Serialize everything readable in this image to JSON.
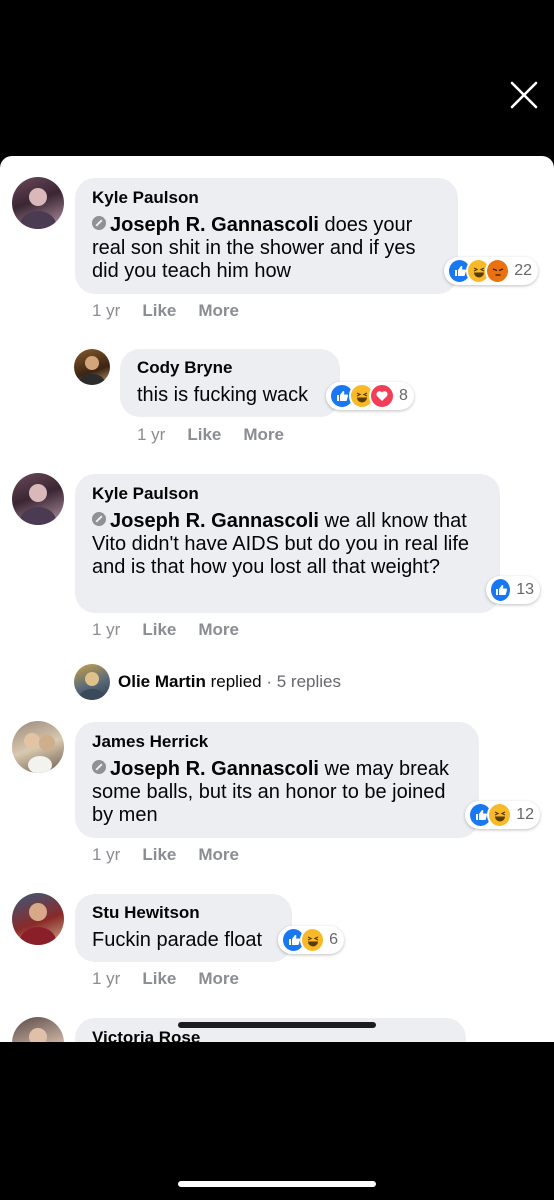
{
  "colors": {
    "like_blue": "#1877f2",
    "haha_yellow": "#f7b928",
    "angry_orange": "#e9710f",
    "love_red": "#f33e58",
    "bubble_gray": "#eceef2",
    "meta_gray": "#8a8d91"
  },
  "actions": {
    "like": "Like",
    "more": "More"
  },
  "comments": [
    {
      "author": "Kyle Paulson",
      "tag": "Joseph R. Gannascoli",
      "text": " does your real son shit in the shower and if yes did you teach him how",
      "reactions": [
        "like",
        "haha",
        "angry"
      ],
      "reaction_count": "22",
      "time": "1 yr"
    },
    {
      "author": "Cody Bryne",
      "text": "this is fucking wack",
      "reactions": [
        "like",
        "haha",
        "love"
      ],
      "reaction_count": "8",
      "time": "1 yr"
    },
    {
      "author": "Kyle Paulson",
      "tag": "Joseph R. Gannascoli",
      "text": " we all know that Vito didn't have AIDS but do you in real life and is that how you lost all that weight?",
      "reactions": [
        "like"
      ],
      "reaction_count": "13",
      "time": "1 yr"
    },
    {
      "author": "James Herrick",
      "tag": "Joseph R. Gannascoli",
      "text": " we may break some balls, but its an honor to be joined by men",
      "reactions": [
        "like",
        "haha"
      ],
      "reaction_count": "12",
      "time": "1 yr"
    },
    {
      "author": "Stu Hewitson",
      "text": "Fuckin parade float",
      "reactions": [
        "like",
        "haha"
      ],
      "reaction_count": "6",
      "time": "1 yr"
    },
    {
      "author": "Victoria Rose"
    }
  ],
  "replies_summary": {
    "name": "Olie Martin",
    "verb": " replied",
    "count": " · 5 replies"
  }
}
